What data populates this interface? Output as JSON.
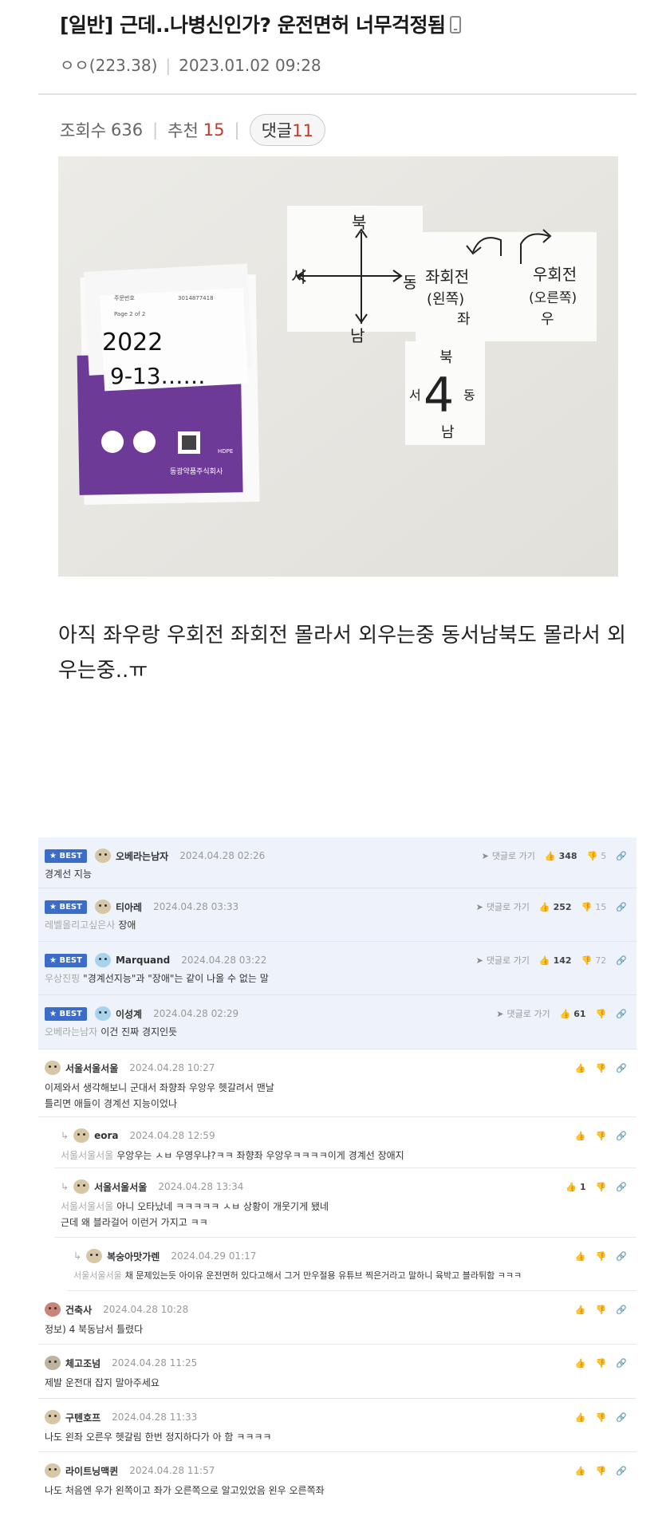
{
  "post": {
    "title": "[일반] 근데..나병신인가? 운전면허 너무걱정됨",
    "author": "ㅇㅇ(223.38)",
    "date": "2023.01.02 09:28",
    "views_label": "조회수",
    "views": "636",
    "recommend_label": "추천",
    "recommend": "15",
    "comments_label": "댓글",
    "comments_count": "11",
    "body": "아직 좌우랑 우회전 좌회전 몰라서 외우는중 동서남북도 몰라서 외우는중..ㅠ"
  },
  "photo": {
    "note_date_line1": "2022",
    "note_date_line2": "9-13……",
    "paper_header1": "주문번호",
    "paper_header2": "Page 2 of 2",
    "paper_code": "3014877418",
    "company": "동광약품주식회사",
    "hdpe": "HDPE",
    "compass_n": "북",
    "compass_s": "남",
    "compass_w": "서",
    "compass_e": "동",
    "left_turn_1": "좌회전",
    "left_turn_2": "(왼쪽)",
    "left_turn_3": "좌",
    "right_turn_1": "우회전",
    "right_turn_2": "(오른쪽)",
    "right_turn_3": "우",
    "small_n": "북",
    "small_w": "서",
    "small_num": "4",
    "small_e": "동",
    "small_s": "남"
  },
  "comments": [
    {
      "best": true,
      "badge": "★ BEST",
      "nick": "오베라는남자",
      "date": "2024.04.28 02:26",
      "reply_label": "댓글로 가기",
      "up": "348",
      "down": "5",
      "text": "경계선 지능",
      "mention": ""
    },
    {
      "best": true,
      "badge": "★ BEST",
      "nick": "티아레",
      "date": "2024.04.28 03:33",
      "reply_label": "댓글로 가기",
      "up": "252",
      "down": "15",
      "text": "장애",
      "mention": "레벨올리고싶은사"
    },
    {
      "best": true,
      "badge": "★ BEST",
      "nick": "Marquand",
      "date": "2024.04.28 03:22",
      "reply_label": "댓글로 가기",
      "up": "142",
      "down": "72",
      "text": "\"경계선지능\"과 \"장애\"는 같이 나올 수 없는 말",
      "mention": "우상진핑"
    },
    {
      "best": true,
      "badge": "★ BEST",
      "nick": "이성계",
      "date": "2024.04.28 02:29",
      "reply_label": "댓글로 가기",
      "up": "61",
      "down": "",
      "text": "이건 진짜 경지인듯",
      "mention": "오베라는남자"
    },
    {
      "nick": "서울서울서울",
      "date": "2024.04.28 10:27",
      "up": "",
      "text1": "이제와서 생각해보니 군대서 좌향좌 우앙우 헷갈려서 맨날",
      "text2": "틀리면 애들이 경계선 지능이었나"
    },
    {
      "nick": "eora",
      "date": "2024.04.28 12:59",
      "up": "",
      "mention": "서울서울서울",
      "text": "우앙우는 ㅅㅂ 우영우냐?ㅋㅋ 좌향좌 우앙우ㅋㅋㅋㅋ이게 경계선 장애지"
    },
    {
      "nick": "서울서울서울",
      "date": "2024.04.28 13:34",
      "up": "1",
      "mention": "서울서울서울",
      "text1": "아니 오타났네 ㅋㅋㅋㅋㅋ ㅅㅂ 상황이 개웃기게 됐네",
      "text2": "근데 왜 블라걸어 이런거 가지고 ㅋㅋ"
    },
    {
      "nick": "복숭아맛가렌",
      "date": "2024.04.29 01:17",
      "up": "",
      "mention": "서울서울서울",
      "text": "채 문제있는듯 아이유 운전면허 있다고해서 그거 만우절용 유튜브 찍은거라고 말하니 육박고 블라튀함 ㅋㅋㅋ"
    },
    {
      "nick": "건축사",
      "date": "2024.04.28 10:28",
      "up": "",
      "text": "정보) 4 북동남서 틀렸다"
    },
    {
      "nick": "체고조넘",
      "date": "2024.04.28 11:25",
      "up": "",
      "text": "제발 운전대 잡지 말아주세요"
    },
    {
      "nick": "구텐호프",
      "date": "2024.04.28 11:33",
      "up": "",
      "text": "나도 왼좌 오른우 헷갈림 한번 정지하다가 아 함 ㅋㅋㅋㅋ"
    },
    {
      "nick": "라이트닝맥퀸",
      "date": "2024.04.28 11:57",
      "up": "",
      "text": "나도 처음엔 우가 왼쪽이고 좌가 오른쪽으로 알고있었음 왼우 오른쪽좌"
    }
  ]
}
